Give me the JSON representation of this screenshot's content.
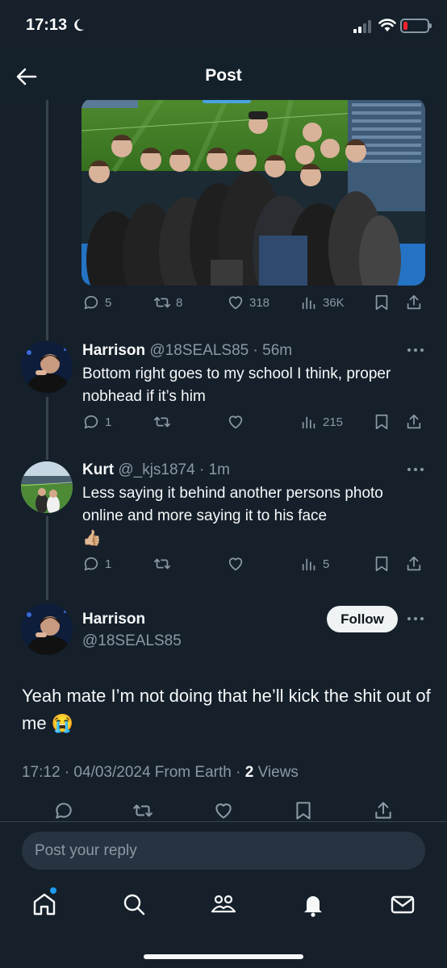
{
  "status_bar": {
    "time": "17:13"
  },
  "header": {
    "title": "Post"
  },
  "parent_post": {
    "stats": {
      "replies": "5",
      "reposts": "8",
      "likes": "318",
      "views": "36K"
    }
  },
  "replies": [
    {
      "name": "Harrison",
      "handle": "@18SEALS85",
      "time": "· 56m",
      "text": "Bottom right goes to my school I think, proper nobhead if it’s him",
      "stats": {
        "replies": "1",
        "views": "215"
      }
    },
    {
      "name": "Kurt",
      "handle": "@_kjs1874",
      "time": "· 1m",
      "text": "Less saying it behind another persons photo online and more saying it to his face",
      "emoji": "👍🏼",
      "stats": {
        "replies": "1",
        "views": "5"
      }
    }
  ],
  "focused_post": {
    "name": "Harrison",
    "handle": "@18SEALS85",
    "follow_label": "Follow",
    "text": "Yeah mate I’m not doing that he’ll kick the shit out of me",
    "emoji": "😭",
    "meta": "17:12 · 04/03/2024 From Earth · ",
    "views_count": "2",
    "views_label": " Views"
  },
  "reply_bar": {
    "placeholder": "Post your reply"
  },
  "tabbar": {
    "icons": [
      "home-icon",
      "search-icon",
      "communities-icon",
      "notifications-icon",
      "messages-icon"
    ],
    "accent": "#1d9bf0"
  },
  "colors": {
    "background": "#15202b",
    "muted": "#8b98a5",
    "text": "#f7f9f9"
  }
}
